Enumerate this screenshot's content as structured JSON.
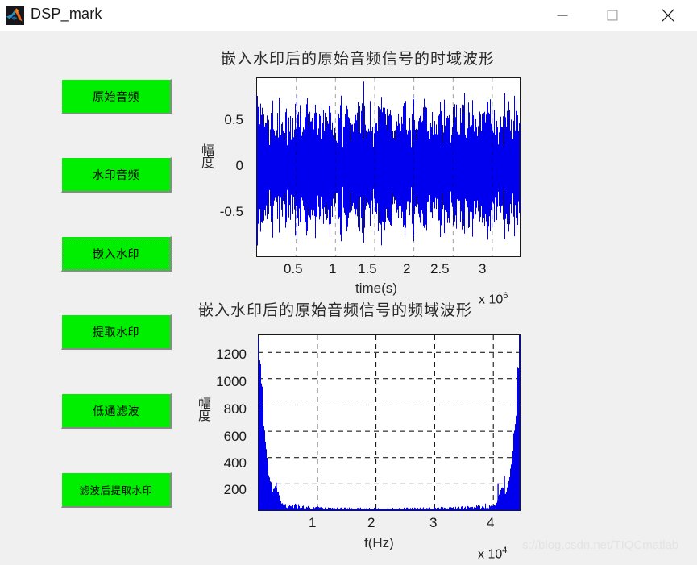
{
  "window": {
    "title": "DSP_mark",
    "icon": "matlab-logo-icon",
    "minimize_label": "—",
    "maximize_label": "□",
    "close_label": "✕"
  },
  "buttons": [
    {
      "label": "原始音频",
      "name": "original-audio-button",
      "focused": false
    },
    {
      "label": "水印音频",
      "name": "watermark-audio-button",
      "focused": false
    },
    {
      "label": "嵌入水印",
      "name": "embed-watermark-button",
      "focused": true
    },
    {
      "label": "提取水印",
      "name": "extract-watermark-button",
      "focused": false
    },
    {
      "label": "低通滤波",
      "name": "lowpass-filter-button",
      "focused": false
    },
    {
      "label": "滤波后提取水印",
      "name": "extract-after-filter-button",
      "focused": false
    }
  ],
  "overlay": {
    "watermark_text": "s://blog.csdn.net/TIQCmatlab"
  },
  "colors": {
    "signal_blue": "#0000ee",
    "button_green": "#00ee00",
    "axes_background": "#ffffff",
    "figure_background": "#f0f0f0"
  },
  "chart_data": [
    {
      "type": "area",
      "name": "time-domain-waveform",
      "title": "嵌入水印后的原始音频信号的时域波形",
      "xlabel": "time(s)",
      "ylabel": "幅度",
      "x_exponent": "x 10",
      "x_exponent_power": "6",
      "xticks": [
        0.5,
        1,
        1.5,
        2,
        2.5,
        3
      ],
      "xtick_labels": [
        "0.5",
        "1",
        "1.5",
        "2",
        "2.5",
        "3"
      ],
      "yticks": [
        0.5,
        0,
        -0.5
      ],
      "ytick_labels": [
        "0.5",
        "0",
        "-0.5"
      ],
      "xlim": [
        0,
        3.35
      ],
      "ylim": [
        -1.0,
        1.0
      ],
      "grid": false,
      "series_color": "#0000ee",
      "description": "Dense full-scale audio waveform, envelope fluctuating between -1 and 1",
      "envelope": [
        0.98,
        0.72,
        0.95,
        0.62,
        0.88,
        0.55,
        0.99,
        0.7,
        0.91,
        0.58,
        0.84,
        0.97,
        0.66,
        0.93,
        0.6,
        0.87,
        0.74,
        1.0,
        0.63,
        0.9,
        0.56,
        0.82,
        0.96,
        0.68,
        0.94,
        0.59,
        0.86,
        0.76,
        0.98,
        0.64,
        0.92,
        0.57,
        0.83,
        0.99,
        0.71,
        0.89,
        0.61,
        0.85,
        0.78,
        0.97,
        0.65,
        0.93,
        0.54,
        0.81,
        0.95,
        0.69,
        0.91,
        0.6,
        0.88,
        0.73,
        1.0,
        0.62,
        0.9,
        0.58,
        0.84,
        0.96,
        0.67,
        0.94,
        0.55,
        0.87,
        0.75,
        0.98,
        0.63,
        0.92,
        0.59,
        0.86,
        0.99,
        0.7,
        0.89,
        0.64
      ]
    },
    {
      "type": "area",
      "name": "frequency-domain-spectrum",
      "title": "嵌入水印后的原始音频信号的频域波形",
      "xlabel": "f(Hz)",
      "ylabel": "幅度",
      "x_exponent": "x 10",
      "x_exponent_power": "4",
      "xticks": [
        1,
        2,
        3,
        4
      ],
      "xtick_labels": [
        "1",
        "2",
        "3",
        "4"
      ],
      "yticks": [
        200,
        400,
        600,
        800,
        1000,
        1200
      ],
      "ytick_labels": [
        "200",
        "400",
        "600",
        "800",
        "1000",
        "1200"
      ],
      "xlim": [
        0,
        4.45
      ],
      "ylim": [
        0,
        1330
      ],
      "grid": true,
      "series_color": "#0000ee",
      "description": "FFT magnitude spectrum, symmetric: large spikes near f=0 and f=4.4e4, near-zero mid band",
      "spectrum_points": [
        {
          "f": 0.02,
          "mag": 1330
        },
        {
          "f": 0.05,
          "mag": 1010
        },
        {
          "f": 0.09,
          "mag": 640
        },
        {
          "f": 0.13,
          "mag": 430
        },
        {
          "f": 0.18,
          "mag": 250
        },
        {
          "f": 0.24,
          "mag": 150
        },
        {
          "f": 0.3,
          "mag": 190
        },
        {
          "f": 0.38,
          "mag": 60
        },
        {
          "f": 0.5,
          "mag": 30
        },
        {
          "f": 0.8,
          "mag": 18
        },
        {
          "f": 1.2,
          "mag": 12
        },
        {
          "f": 1.8,
          "mag": 10
        },
        {
          "f": 2.2,
          "mag": 9
        },
        {
          "f": 2.8,
          "mag": 11
        },
        {
          "f": 3.2,
          "mag": 14
        },
        {
          "f": 3.7,
          "mag": 18
        },
        {
          "f": 4.05,
          "mag": 40
        },
        {
          "f": 4.15,
          "mag": 190
        },
        {
          "f": 4.22,
          "mag": 120
        },
        {
          "f": 4.28,
          "mag": 260
        },
        {
          "f": 4.33,
          "mag": 450
        },
        {
          "f": 4.38,
          "mag": 700
        },
        {
          "f": 4.42,
          "mag": 1040
        },
        {
          "f": 4.45,
          "mag": 1330
        }
      ]
    }
  ]
}
